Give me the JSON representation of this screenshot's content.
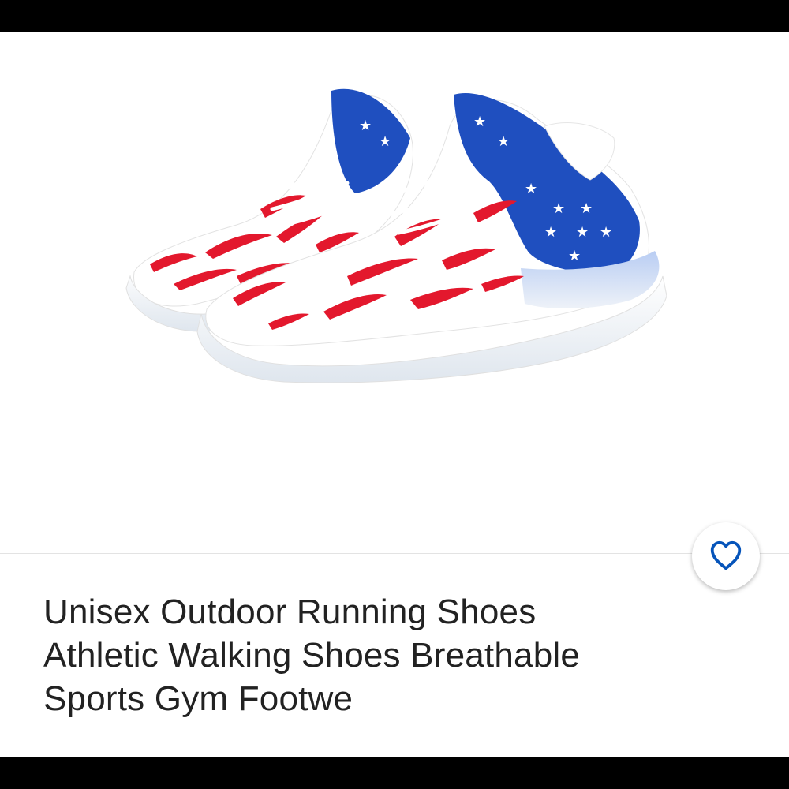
{
  "product": {
    "title_lines": [
      "Unisex Outdoor Running Shoes",
      "Athletic Walking Shoes Breathable",
      "Sports Gym Footwe"
    ],
    "image_icon": "sneakers-product-image",
    "favorite_icon": "heart-outline-icon"
  },
  "colors": {
    "accent": "#0654ba",
    "shoe_blue": "#1f4fbf",
    "shoe_red": "#e3182d",
    "title_text": "#222222"
  }
}
